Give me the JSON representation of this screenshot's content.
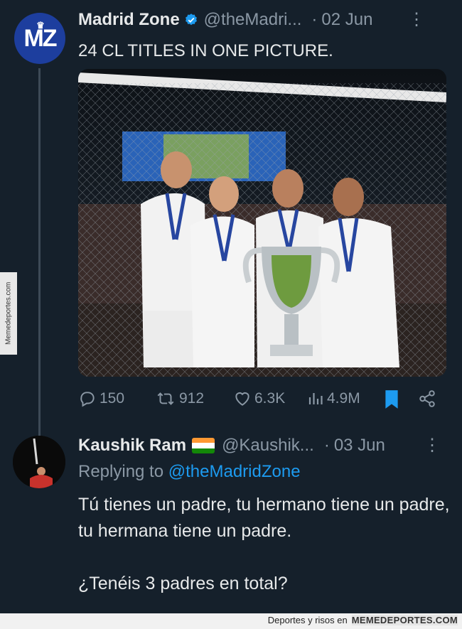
{
  "tweet": {
    "author_name": "Madrid Zone",
    "handle": "@theMadri...",
    "separator": "·",
    "date": "02 Jun",
    "text": "24 CL TITLES IN ONE PICTURE.",
    "avatar_text": "MZ",
    "stats": {
      "replies": "150",
      "retweets": "912",
      "likes": "6.3K",
      "views": "4.9M"
    }
  },
  "reply": {
    "author_name": "Kaushik Ram",
    "handle": "@Kaushik...",
    "separator": "·",
    "date": "03 Jun",
    "replying_prefix": "Replying to",
    "replying_mention": "@theMadridZone",
    "line1": "Tú tienes un padre, tu hermano tiene un padre, tu hermana tiene un padre.",
    "line2": "¿Tenéis 3 padres en total?"
  },
  "watermark": {
    "side_text": "Memedeportes.com",
    "footer_text": "Deportes y risos en",
    "footer_site": "MEMEDEPORTES.COM"
  },
  "colors": {
    "background": "#15202b",
    "accent": "#1d9bf0",
    "muted": "#8b98a5"
  }
}
